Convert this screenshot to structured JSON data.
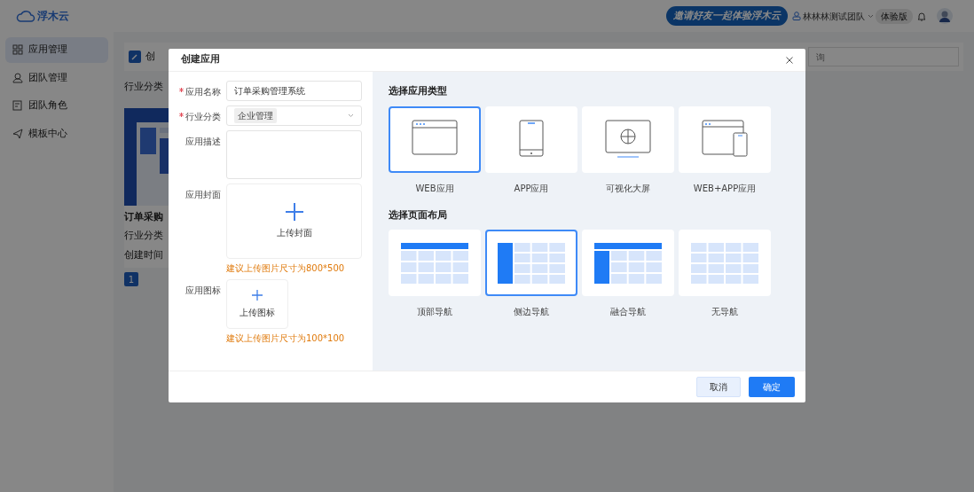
{
  "header": {
    "logo_text": "浮木云",
    "invite_button": "邀请好友一起体验浮木云",
    "team_name": "林林林测试团队",
    "team_badge": "体验版"
  },
  "sidebar": {
    "items": [
      {
        "label": "应用管理",
        "selected": true
      },
      {
        "label": "团队管理",
        "selected": false
      },
      {
        "label": "团队角色",
        "selected": false
      },
      {
        "label": "模板中心",
        "selected": false
      }
    ]
  },
  "page": {
    "toolbar_title": "创",
    "search": {
      "placeholder": "询"
    },
    "filter_label": "行业分类",
    "app_card": {
      "title": "订单采购",
      "lines": [
        "行业分类",
        "创建时间"
      ]
    },
    "pagination": [
      {
        "label": "1",
        "selected": true
      }
    ]
  },
  "dialog": {
    "title": "创建应用",
    "fields": [
      {
        "kind": "text",
        "label": "应用名称",
        "required": true,
        "value": "订单采购管理系统"
      },
      {
        "kind": "select",
        "label": "行业分类",
        "required": true,
        "tags": [
          "企业管理"
        ]
      },
      {
        "kind": "textarea",
        "label": "应用描述",
        "required": false
      },
      {
        "kind": "cover",
        "label": "应用封面",
        "required": false,
        "text": "上传封面",
        "hint": "建议上传图片尺寸为800*500"
      },
      {
        "kind": "icon",
        "label": "应用图标",
        "required": false,
        "text": "上传图标",
        "hint": "建议上传图片尺寸为100*100"
      }
    ],
    "app_types": {
      "heading": "选择应用类型",
      "options": [
        {
          "kind": "web",
          "label": "WEB应用",
          "selected": true
        },
        {
          "kind": "app",
          "label": "APP应用",
          "selected": false
        },
        {
          "kind": "screen",
          "label": "可视化大屏",
          "selected": false
        },
        {
          "kind": "webapp",
          "label": "WEB+APP应用",
          "selected": false
        }
      ]
    },
    "layouts": {
      "heading": "选择页面布局",
      "options": [
        {
          "kind": "top",
          "label": "顶部导航",
          "selected": false
        },
        {
          "kind": "side",
          "label": "侧边导航",
          "selected": true
        },
        {
          "kind": "mixed",
          "label": "融合导航",
          "selected": false
        },
        {
          "kind": "none",
          "label": "无导航",
          "selected": false
        }
      ]
    },
    "buttons": [
      {
        "kind": "secondary",
        "label": "取消"
      },
      {
        "kind": "primary",
        "label": "确定"
      }
    ]
  }
}
